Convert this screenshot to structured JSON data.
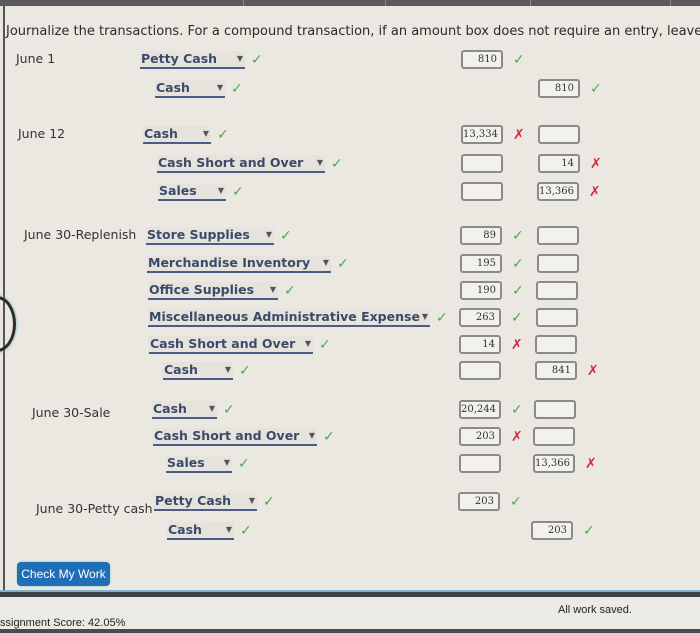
{
  "instruction": "Journalize the transactions. For a compound transaction, if an amount box does not require an entry, leave it blank.",
  "entries": [
    {
      "date": "June 1",
      "lines": [
        {
          "account": "Petty Cash",
          "account_status": "correct",
          "debit": "810",
          "debit_status": "correct",
          "credit": "",
          "credit_status": ""
        },
        {
          "account": "Cash",
          "account_status": "correct",
          "debit": "",
          "debit_status": "",
          "credit": "810",
          "credit_status": "correct"
        }
      ]
    },
    {
      "date": "June 12",
      "lines": [
        {
          "account": "Cash",
          "account_status": "correct",
          "debit": "13,334",
          "debit_status": "incorrect",
          "credit": "",
          "credit_status": ""
        },
        {
          "account": "Cash Short and Over",
          "account_status": "correct",
          "debit": "",
          "debit_status": "",
          "credit": "14",
          "credit_status": "incorrect"
        },
        {
          "account": "Sales",
          "account_status": "correct",
          "debit": "",
          "debit_status": "",
          "credit": "13,366",
          "credit_status": "incorrect"
        }
      ]
    },
    {
      "date": "June 30-Replenish",
      "lines": [
        {
          "account": "Store Supplies",
          "account_status": "correct",
          "debit": "89",
          "debit_status": "correct",
          "credit": "",
          "credit_status": ""
        },
        {
          "account": "Merchandise Inventory",
          "account_status": "correct",
          "debit": "195",
          "debit_status": "correct",
          "credit": "",
          "credit_status": ""
        },
        {
          "account": "Office Supplies",
          "account_status": "correct",
          "debit": "190",
          "debit_status": "correct",
          "credit": "",
          "credit_status": ""
        },
        {
          "account": "Miscellaneous Administrative Expense",
          "account_status": "correct",
          "debit": "263",
          "debit_status": "correct",
          "credit": "",
          "credit_status": ""
        },
        {
          "account": "Cash Short and Over",
          "account_status": "correct",
          "debit": "14",
          "debit_status": "incorrect",
          "credit": "",
          "credit_status": ""
        },
        {
          "account": "Cash",
          "account_status": "correct",
          "debit": "",
          "debit_status": "",
          "credit": "841",
          "credit_status": "incorrect"
        }
      ]
    },
    {
      "date": "June 30-Sale",
      "lines": [
        {
          "account": "Cash",
          "account_status": "correct",
          "debit": "20,244",
          "debit_status": "correct",
          "credit": "",
          "credit_status": ""
        },
        {
          "account": "Cash Short and Over",
          "account_status": "correct",
          "debit": "203",
          "debit_status": "incorrect",
          "credit": "",
          "credit_status": ""
        },
        {
          "account": "Sales",
          "account_status": "correct",
          "debit": "",
          "debit_status": "",
          "credit": "13,366",
          "credit_status": "incorrect"
        }
      ]
    },
    {
      "date": "June 30-Petty cash",
      "lines": [
        {
          "account": "Petty Cash",
          "account_status": "correct",
          "debit": "203",
          "debit_status": "correct",
          "credit": "",
          "credit_status": ""
        },
        {
          "account": "Cash",
          "account_status": "correct",
          "debit": "",
          "debit_status": "",
          "credit": "203",
          "credit_status": "correct"
        }
      ]
    }
  ],
  "marks": {
    "correct": "✓",
    "incorrect": "✗"
  },
  "check_button": "Check My Work",
  "footer": {
    "score": "ssignment Score: 42.05%",
    "saved": "All work saved."
  },
  "colors": {
    "correct": "#4caa4a",
    "incorrect": "#d6283a",
    "button": "#1f6fb8",
    "account_text": "#3b4a6a"
  }
}
